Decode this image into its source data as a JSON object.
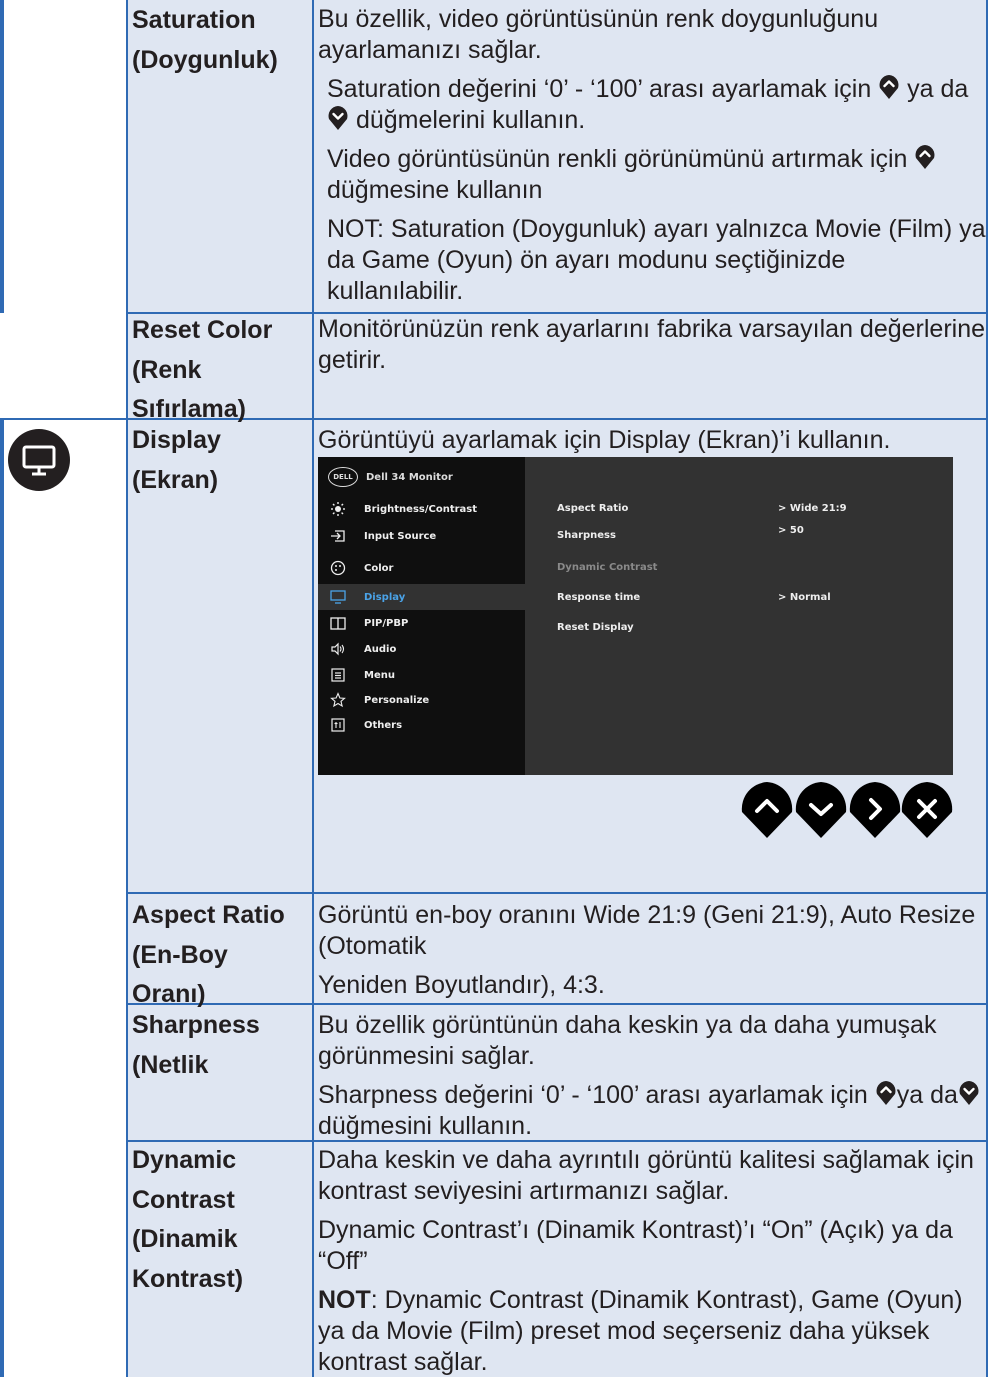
{
  "rows": {
    "saturation": {
      "term_en": "Saturation",
      "term_tr": "(Doygunluk)",
      "p1": "Bu özellik, video görüntüsünün renk doygunluğunu ayarlamanızı sağlar.",
      "p2_a": "Saturation değerini ‘0’ - ‘100’ arası ayarlamak için",
      "p2_b": "ya",
      "p2_c": "da",
      "p2_d": "düğmelerini kullanın.",
      "p3_a": "Video görüntüsünün renkli görünümünü artırmak için",
      "p3_b": "düğmesine kullanın",
      "p4": "NOT: Saturation (Doygunluk) ayarı yalnızca Movie (Film) ya da Game (Oyun) ön ayarı modunu seçtiğinizde kullanılabilir."
    },
    "reset_color": {
      "term_en": "Reset Color",
      "term_tr1": "(Renk",
      "term_tr2": "Sıfırlama)",
      "p1": "Monitörünüzün renk ayarlarını fabrika varsayılan değerlerine getirir."
    },
    "display": {
      "icon": "monitor-icon",
      "term_en": "Display",
      "term_tr": "(Ekran)",
      "p1": "Görüntüyü ayarlamak için Display (Ekran)’i kullanın."
    },
    "aspect_ratio": {
      "term_en": "Aspect Ratio",
      "term_tr1": "(En-Boy",
      "term_tr2": "Oranı)",
      "p1": "Görüntü en-boy oranını Wide 21:9 (Geni 21:9), Auto Resize (Otomatik",
      "p2": "Yeniden Boyutlandır), 4:3."
    },
    "sharpness": {
      "term_en": "Sharpness",
      "term_tr": "(Netlik",
      "p1": "Bu özellik görüntünün daha keskin ya da daha yumuşak görünmesini sağlar.",
      "p2_a": "Sharpness değerini ‘0’ - ‘100’ arası ayarlamak için",
      "p2_b": "ya",
      "p2_c": "da",
      "p2_d": "düğmesini kullanın."
    },
    "dynamic_contrast": {
      "term_1": "Dynamic",
      "term_2": "Contrast",
      "term_3": "(Dinamik",
      "term_4": "Kontrast)",
      "p1": "Daha keskin ve daha ayrıntılı görüntü kalitesi sağlamak için kontrast seviyesini artırmanızı sağlar.",
      "p2": "Dynamic Contrast’ı (Dinamik Kontrast)’ı “On” (Açık) ya da “Off”",
      "p3_bold": "NOT",
      "p3_rest": ": Dynamic Contrast (Dinamik Kontrast), Game (Oyun) ya da Movie (Film) preset mod seçerseniz daha yüksek kontrast sağlar."
    }
  },
  "osd": {
    "logo_text": "DELL",
    "title": "Dell 34 Monitor",
    "selected_index": 3,
    "menu": [
      {
        "label": "Brightness/Contrast",
        "icon": "brightness-icon"
      },
      {
        "label": "Input Source",
        "icon": "input-source-icon"
      },
      {
        "label": "Color",
        "icon": "color-palette-icon"
      },
      {
        "label": "Display",
        "icon": "monitor-icon"
      },
      {
        "label": "PIP/PBP",
        "icon": "pip-icon"
      },
      {
        "label": "Audio",
        "icon": "speaker-icon"
      },
      {
        "label": "Menu",
        "icon": "menu-list-icon"
      },
      {
        "label": "Personalize",
        "icon": "star-icon"
      },
      {
        "label": "Others",
        "icon": "others-icon"
      }
    ],
    "options": [
      {
        "label": "Aspect Ratio",
        "value": "> Wide 21:9"
      },
      {
        "label": "Sharpness",
        "value": "> 50"
      },
      {
        "label": "Dynamic Contrast",
        "value": ""
      },
      {
        "label": "Response time",
        "value": "> Normal"
      },
      {
        "label": "Reset Display",
        "value": ""
      }
    ],
    "buttons": [
      "up-button",
      "down-button",
      "right-button",
      "close-button"
    ]
  },
  "colors": {
    "table_bg": "#dfe6f2",
    "border": "#2f6ab4",
    "osd_panel": "#323232",
    "osd_menu": "#0f0f0f",
    "osd_selected": "#4aa3e8"
  }
}
